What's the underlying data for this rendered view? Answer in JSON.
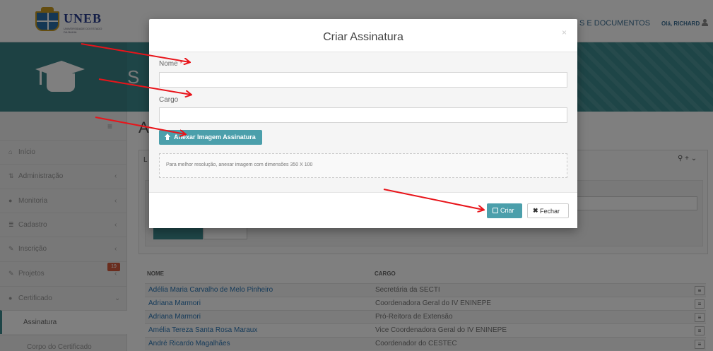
{
  "header": {
    "logo_text": "UNEB",
    "logo_subtitle": "UNIVERSIDADE DO ESTADO DA BAHIA",
    "nav_docs": "S E DOCUMENTOS",
    "user_greeting": "Olá, RICHARD"
  },
  "banner": {
    "partial_title": "S"
  },
  "sidebar": {
    "items": [
      {
        "label": "Início",
        "icon": "home-icon"
      },
      {
        "label": "Administração",
        "icon": "sliders-icon"
      },
      {
        "label": "Monitoria",
        "icon": "users-icon"
      },
      {
        "label": "Cadastro",
        "icon": "list-icon"
      },
      {
        "label": "Inscrição",
        "icon": "edit-icon"
      },
      {
        "label": "Projetos",
        "icon": "edit-icon",
        "badge": "19"
      },
      {
        "label": "Certificado",
        "icon": "circle-icon"
      },
      {
        "label": "Assinatura"
      },
      {
        "label": "Corpo do Certificado"
      }
    ]
  },
  "main": {
    "heading": "A",
    "panel_label": "L"
  },
  "table": {
    "headers": [
      "NOME",
      "CARGO"
    ],
    "rows": [
      {
        "nome": "Adélia Maria Carvalho de Melo Pinheiro",
        "cargo": "Secretária da SECTI"
      },
      {
        "nome": "Adriana Marmori",
        "cargo": "Coordenadora Geral do IV ENINEPE"
      },
      {
        "nome": "Adriana Marmori",
        "cargo": "Pró-Reitora de Extensão"
      },
      {
        "nome": "Amélia Tereza Santa Rosa Maraux",
        "cargo": "Vice Coordenadora Geral do IV ENINEPE"
      },
      {
        "nome": "André Ricardo Magalhães",
        "cargo": "Coordenador do CESTEC"
      }
    ]
  },
  "modal": {
    "title": "Criar Assinatura",
    "close": "×",
    "nome_label": "Nome",
    "nome_required": "*",
    "nome_value": "",
    "cargo_label": "Cargo",
    "cargo_value": "",
    "attach_label": "Anexar Imagem Assinatura",
    "hint": "Para melhor resolução, anexar imagem com dimensões 350 X 100",
    "criar_label": "Criar",
    "fechar_label": "Fechar"
  },
  "colors": {
    "teal": "#3d8b8f",
    "button_teal": "#4b9fab",
    "arrow_red": "#e8141a",
    "badge_red": "#d55a3c"
  }
}
